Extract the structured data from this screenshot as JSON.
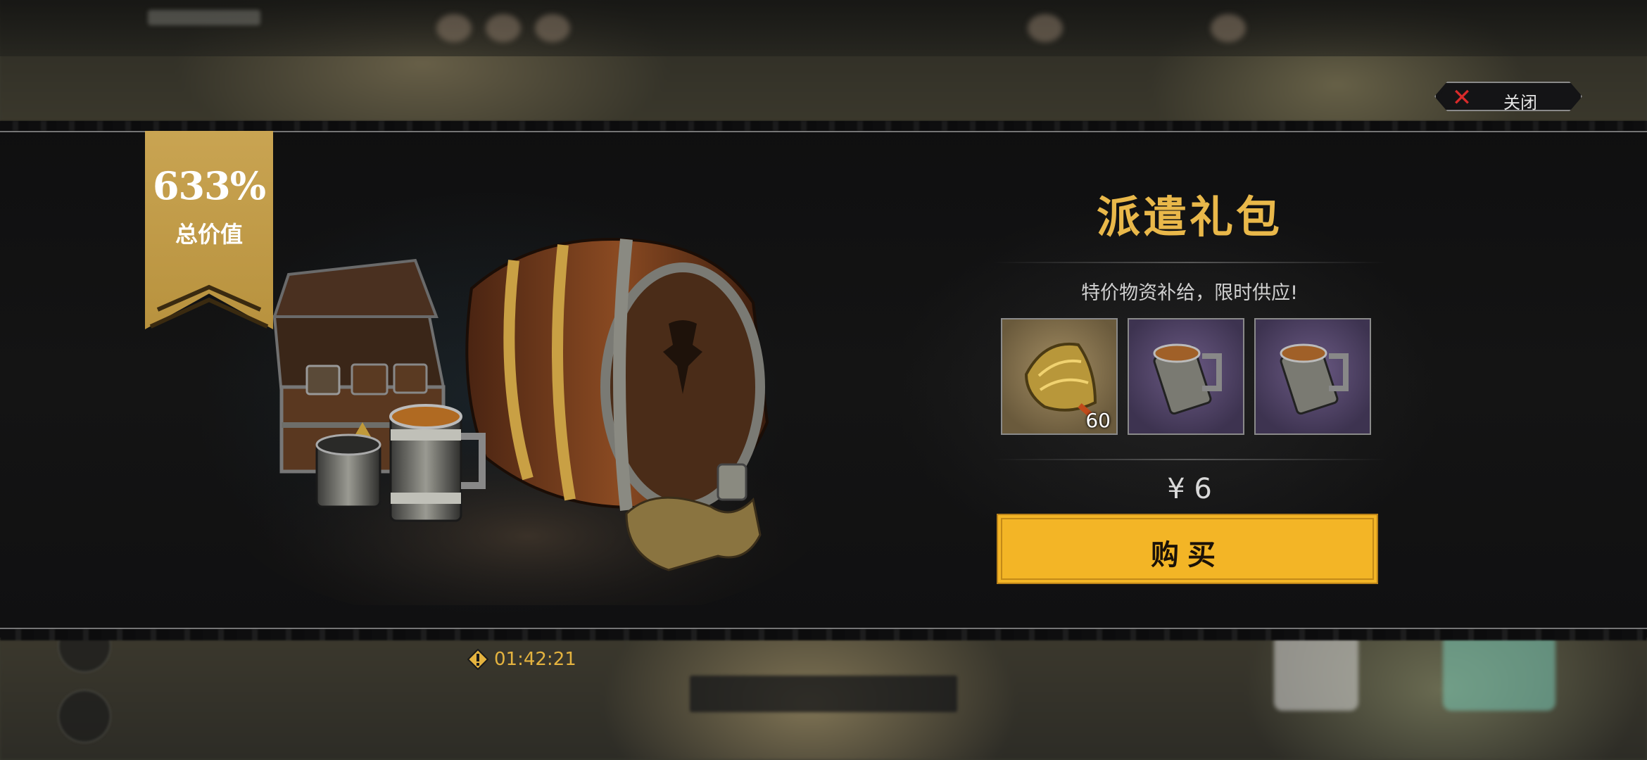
{
  "header": {
    "close_label": "关闭"
  },
  "offer": {
    "badge_percent": "633%",
    "badge_label": "总价值",
    "title": "派遣礼包",
    "subtitle": "特价物资补给，限时供应!",
    "items": [
      {
        "icon": "golden-husk-icon",
        "quantity": "60",
        "rarity": "gold"
      },
      {
        "icon": "tankard-icon",
        "quantity": "",
        "rarity": "purple"
      },
      {
        "icon": "tankard-icon",
        "quantity": "",
        "rarity": "purple"
      }
    ],
    "price": "¥ 6",
    "buy_label": "购买"
  },
  "timer": {
    "icon": "warning-diamond-icon",
    "value": "01:42:21"
  },
  "colors": {
    "title_gold": "#e9b84a",
    "buy_button": "#f3b526",
    "ribbon": "#c9a452",
    "timer": "#e4b33f",
    "close_x": "#d92a2a"
  }
}
